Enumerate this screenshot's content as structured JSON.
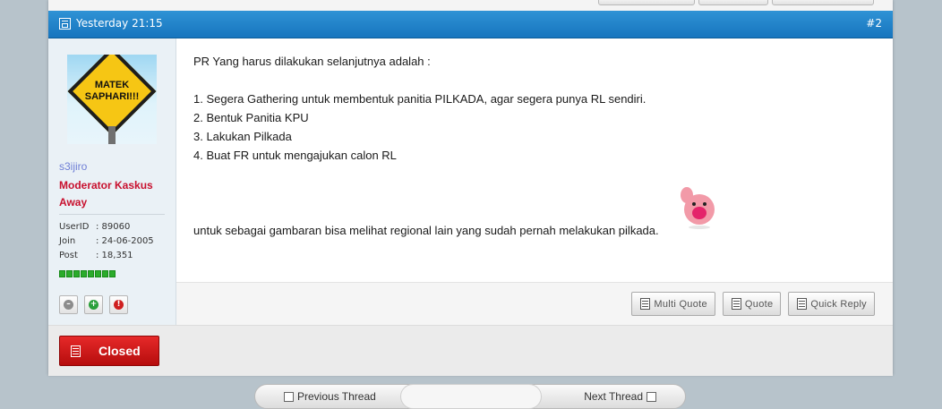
{
  "header": {
    "date": "Yesterday 21:15",
    "post_number": "#2",
    "accent_color": "#1f82c9"
  },
  "user": {
    "avatar_text": "MATEK SAPHARI!!!",
    "username": "s3ijiro",
    "role": "Moderator Kaskus",
    "status": "Away",
    "stats": [
      {
        "label": "UserID",
        "value": ": 89060"
      },
      {
        "label": "Join",
        "value": ": 24-06-2005"
      },
      {
        "label": "Post",
        "value": ": 18,351"
      }
    ],
    "reputation_bars": 8,
    "icons": [
      "minus-icon",
      "plus-icon",
      "report-icon"
    ]
  },
  "post": {
    "intro": "PR Yang harus dilakukan selanjutnya adalah :",
    "items": [
      "1. Segera Gathering untuk membentuk panitia PILKADA, agar segera punya RL sendiri.",
      "2. Bentuk Panitia KPU",
      "3. Lakukan Pilkada",
      "4. Buat FR untuk mengajukan calon RL"
    ],
    "closing": "untuk sebagai gambaran bisa melihat regional lain yang sudah pernah melakukan pilkada."
  },
  "actions": {
    "multi_quote": "Multi Quote",
    "quote": "Quote",
    "quick_reply": "Quick Reply"
  },
  "status_button": {
    "label": "Closed",
    "color": "#d01818"
  },
  "thread_nav": {
    "prev": "Previous Thread",
    "next": "Next Thread"
  }
}
